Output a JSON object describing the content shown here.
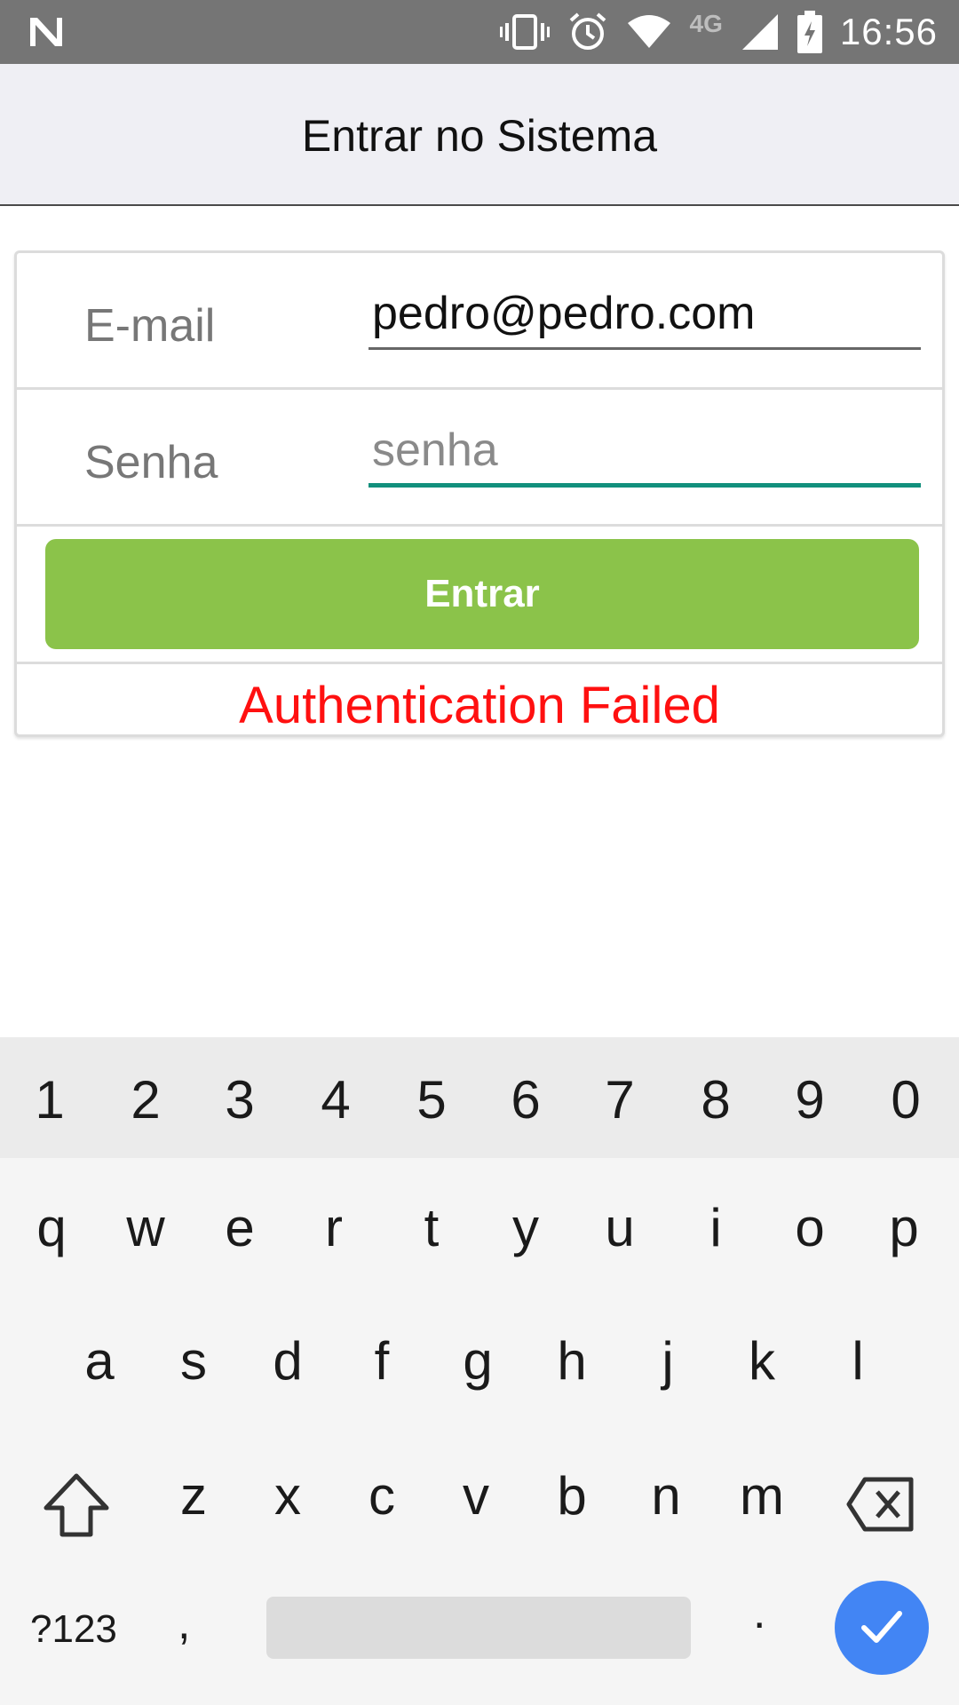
{
  "status_bar": {
    "time": "16:56",
    "network_type": "4G",
    "icons": [
      "notification-n-icon",
      "vibrate-icon",
      "alarm-icon",
      "wifi-icon",
      "signal-icon",
      "battery-charging-icon"
    ]
  },
  "app_bar": {
    "title": "Entrar no Sistema"
  },
  "login_form": {
    "email_label": "E-mail",
    "email_value": "pedro@pedro.com",
    "password_label": "Senha",
    "password_placeholder": "senha",
    "submit_label": "Entrar",
    "error_message": "Authentication Failed",
    "colors": {
      "button": "#8bc34a",
      "error": "#ff1010",
      "focus_underline": "#12907d"
    }
  },
  "keyboard": {
    "numbers": [
      "1",
      "2",
      "3",
      "4",
      "5",
      "6",
      "7",
      "8",
      "9",
      "0"
    ],
    "row1": [
      "q",
      "w",
      "e",
      "r",
      "t",
      "y",
      "u",
      "i",
      "o",
      "p"
    ],
    "row2": [
      "a",
      "s",
      "d",
      "f",
      "g",
      "h",
      "j",
      "k",
      "l"
    ],
    "row3": [
      "z",
      "x",
      "c",
      "v",
      "b",
      "n",
      "m"
    ],
    "symbols_label": "?123",
    "comma": ",",
    "period": ".",
    "icons": [
      "shift-icon",
      "backspace-icon",
      "done-check-icon"
    ],
    "done_color": "#4285f4"
  }
}
